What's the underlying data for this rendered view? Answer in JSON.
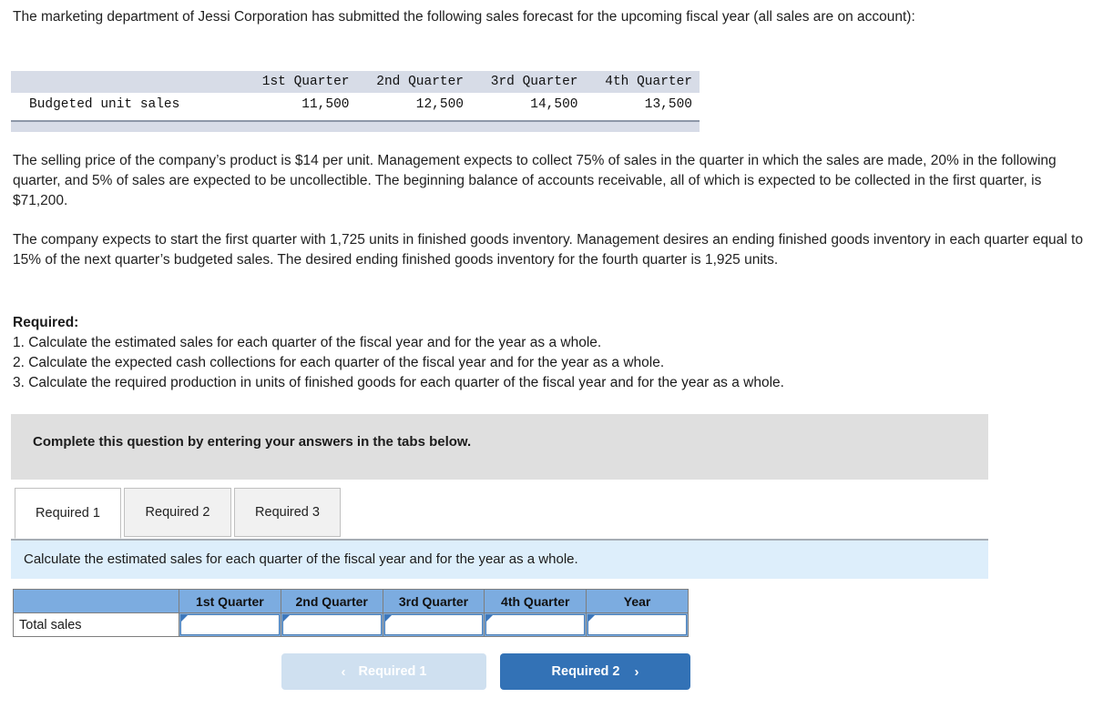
{
  "intro": {
    "paragraph": "The marketing department of Jessi Corporation has submitted the following sales forecast for the upcoming fiscal year (all sales are on account):"
  },
  "budget_table": {
    "corner_label": "",
    "columns": [
      "1st Quarter",
      "2nd Quarter",
      "3rd Quarter",
      "4th Quarter"
    ],
    "rows": [
      {
        "label": "Budgeted unit sales",
        "values": [
          "11,500",
          "12,500",
          "14,500",
          "13,500"
        ]
      }
    ]
  },
  "paragraphs": {
    "selling": "The selling price of the company’s product is $14 per unit. Management expects to collect 75% of sales in the quarter in which the sales are made, 20% in the following quarter, and 5% of sales are expected to be uncollectible. The beginning balance of accounts receivable, all of which is expected to be collected in the first quarter, is $71,200.",
    "inventory": "The company expects to start the first quarter with 1,725 units in finished goods inventory. Management desires an ending finished goods inventory in each quarter equal to 15% of the next quarter’s budgeted sales. The desired ending finished goods inventory for the fourth quarter is 1,925 units."
  },
  "required": {
    "title": "Required:",
    "items": [
      "1. Calculate the estimated sales for each quarter of the fiscal year and for the year as a whole.",
      "2. Calculate the expected cash collections for each quarter of the fiscal year and for the year as a whole.",
      "3. Calculate the required production in units of finished goods for each quarter of the fiscal year and for the year as a whole."
    ]
  },
  "banner": {
    "text": "Complete this question by entering your answers in the tabs below."
  },
  "tabs": [
    {
      "label": "Required 1",
      "active": true
    },
    {
      "label": "Required 2",
      "active": false
    },
    {
      "label": "Required 3",
      "active": false
    }
  ],
  "instruction": {
    "text": "Calculate the estimated sales for each quarter of the fiscal year and for the year as a whole."
  },
  "answer_table": {
    "corner_label": "",
    "columns": [
      "1st Quarter",
      "2nd Quarter",
      "3rd Quarter",
      "4th Quarter",
      "Year"
    ],
    "rows": [
      {
        "label": "Total sales",
        "values": [
          "",
          "",
          "",
          "",
          ""
        ]
      }
    ]
  },
  "nav": {
    "prev_label": "Required 1",
    "prev_chevron": "‹",
    "next_label": "Required 2",
    "next_chevron": "›"
  },
  "colors": {
    "banner_gray": "#dfdfdf",
    "instruction_blue": "#ddeefb",
    "table_header_blue": "#7cace0",
    "budget_header": "#d7dce7",
    "next_button": "#3372b6",
    "prev_button": "#cfe0f0"
  }
}
